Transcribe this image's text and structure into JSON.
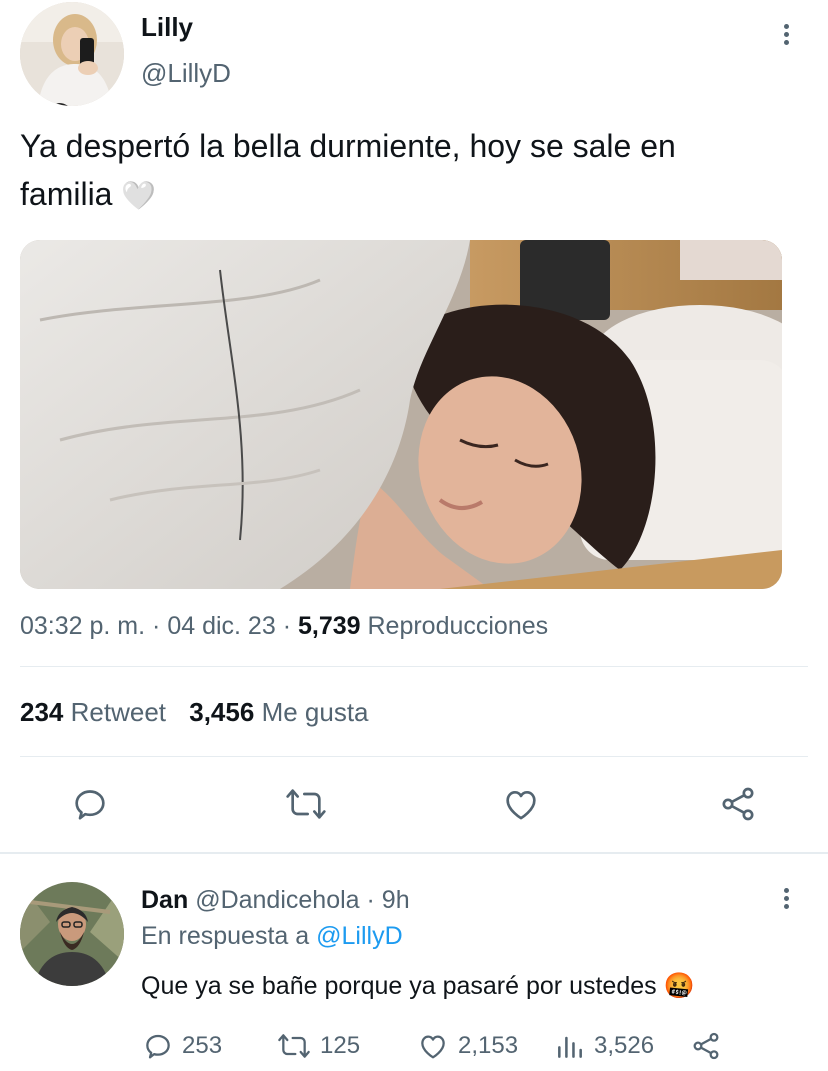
{
  "tweet": {
    "author_name": "Lilly",
    "author_handle": "@LillyD",
    "text_line1": "Ya despertó la bella durmiente, hoy se sale en",
    "text_line2": "familia",
    "emoji": "🤍",
    "time": "03:32 p. m.",
    "sep1": "·",
    "date": "04 dic. 23",
    "sep2": "·",
    "views_count": "5,739",
    "views_label": "Reproducciones",
    "retweets_count": "234",
    "retweets_label": "Retweet",
    "likes_count": "3,456",
    "likes_label": "Me gusta"
  },
  "reply": {
    "author_name": "Dan",
    "author_handle": "@Dandicehola",
    "sep": "·",
    "time_ago": "9h",
    "reply_prefix": "En respuesta a",
    "reply_to": "@LillyD",
    "text": "Que ya se bañe porque ya pasaré por ustedes",
    "emoji": "🤬",
    "comments": "253",
    "retweets": "125",
    "likes": "2,153",
    "views": "3,526"
  },
  "colors": {
    "text": "#0f1419",
    "muted": "#536471",
    "link": "#1d9bf0",
    "divider": "#e6ecf0"
  },
  "icons": [
    "more-icon",
    "reply-icon",
    "retweet-icon",
    "like-icon",
    "share-icon",
    "views-icon"
  ]
}
